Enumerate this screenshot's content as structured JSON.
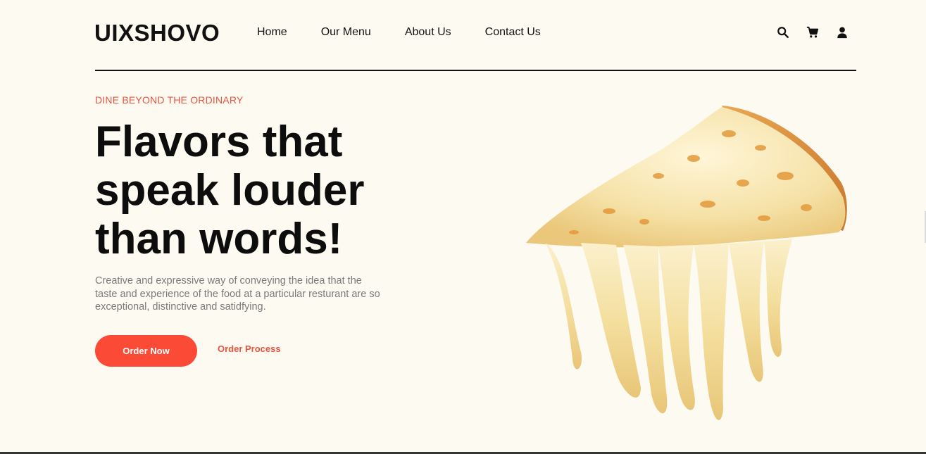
{
  "brand": {
    "logo": "UIXSHOVO"
  },
  "nav": {
    "items": [
      {
        "label": "Home"
      },
      {
        "label": "Our Menu"
      },
      {
        "label": "About Us"
      },
      {
        "label": "Contact Us"
      }
    ],
    "icons": [
      "search-icon",
      "cart-icon",
      "user-icon"
    ]
  },
  "hero": {
    "eyebrow": "DINE BEYOND THE ORDINARY",
    "headline_line1": "Flavors that",
    "headline_line2": "speak louder",
    "headline_line3": "than words!",
    "description": "Creative and expressive way of conveying the idea that the taste and experience of the food at a particular resturant are so exceptional, distinctive and satidfying.",
    "primary_button": "Order Now",
    "secondary_link": "Order Process",
    "image": "cheesy-pizza-slice-image"
  },
  "colors": {
    "background": "#fdfaf2",
    "accent": "#fb4a35",
    "eyebrow": "#e8543e",
    "text": "#111111",
    "muted": "#7a7a7a"
  }
}
